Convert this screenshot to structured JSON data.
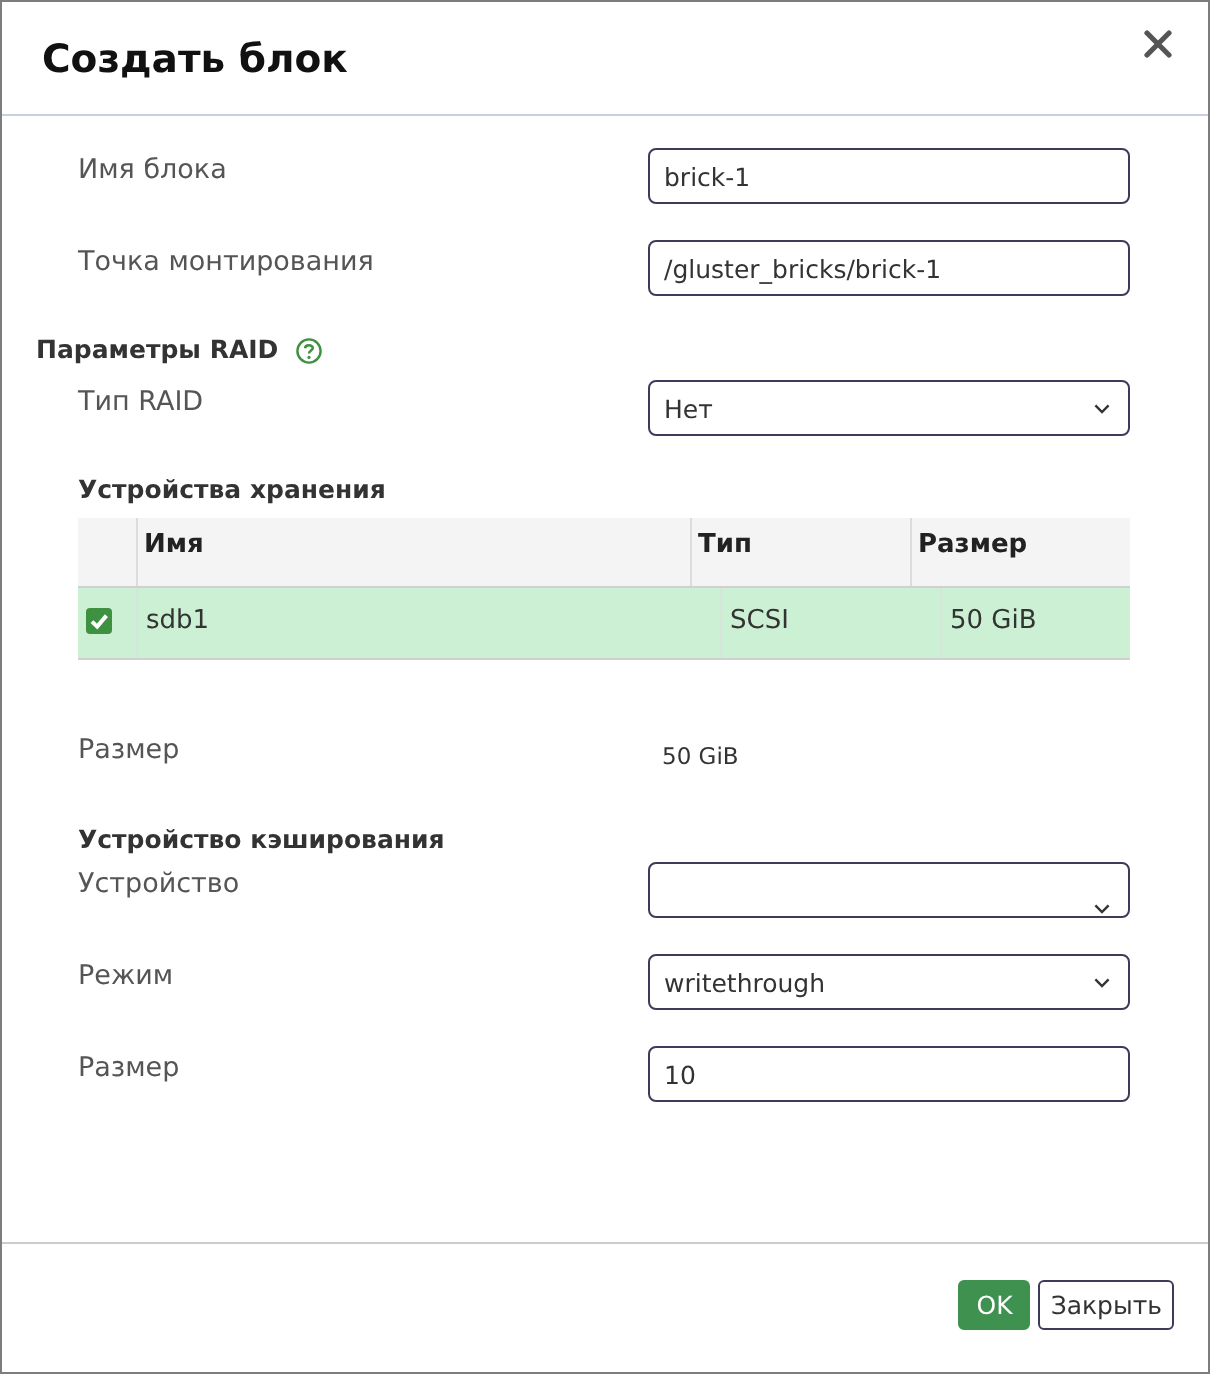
{
  "dialog": {
    "title": "Создать блок"
  },
  "brick_fields": [
    {
      "kind": "input",
      "label": "Имя блока",
      "value": "brick-1"
    },
    {
      "kind": "input",
      "label": "Точка монтирования",
      "value": "/gluster_bricks/brick-1"
    }
  ],
  "raid": {
    "title": "Параметры RAID",
    "fields": [
      {
        "kind": "select",
        "label": "Тип RAID",
        "value": "Нет"
      }
    ],
    "storage_devices": {
      "title": "Устройства хранения",
      "columns": [
        "Имя",
        "Тип",
        "Размер"
      ],
      "rows": [
        {
          "selected": true,
          "cells": [
            "sdb1",
            "SCSI",
            "50 GiB"
          ]
        }
      ]
    },
    "summary": [
      {
        "kind": "text",
        "label": "Размер",
        "value": "50 GiB"
      }
    ]
  },
  "cache": {
    "title": "Устройство кэширования",
    "fields": [
      {
        "kind": "select",
        "label": "Устройство"
      },
      {
        "kind": "select",
        "label": "Режим",
        "value": "writethrough"
      },
      {
        "kind": "input",
        "label": "Размер",
        "value": "10"
      }
    ]
  },
  "buttons": [
    {
      "kind": "primary",
      "label": "OK"
    },
    {
      "kind": "default",
      "label": "Закрыть"
    }
  ]
}
